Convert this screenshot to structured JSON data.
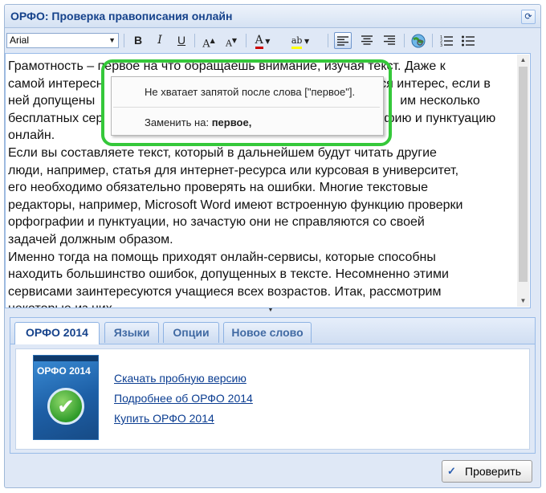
{
  "window": {
    "title": "ОРФО: Проверка правописания онлайн"
  },
  "toolbar": {
    "font": "Arial",
    "buttons": [
      {
        "name": "bold-button",
        "glyph": "B"
      },
      {
        "name": "italic-button",
        "glyph": "I"
      },
      {
        "name": "underline-button",
        "glyph": "U"
      },
      {
        "name": "increase-font-button",
        "glyph": "A↑"
      },
      {
        "name": "decrease-font-button",
        "glyph": "A↓"
      },
      {
        "name": "font-color-button",
        "glyph": "A"
      },
      {
        "name": "highlight-button",
        "glyph": "ab"
      },
      {
        "name": "align-left-button",
        "glyph": "≡"
      },
      {
        "name": "align-center-button",
        "glyph": "≡"
      },
      {
        "name": "align-right-button",
        "glyph": "≡"
      },
      {
        "name": "insert-link-button",
        "glyph": "🌐"
      },
      {
        "name": "numbered-list-button",
        "glyph": "⋮≡"
      },
      {
        "name": "bullet-list-button",
        "glyph": "⋮≡"
      }
    ],
    "colors": {
      "font_color_bar": "#cc0000",
      "highlight_bar": "#ffff00"
    }
  },
  "editor": {
    "text": {
      "l1": "Грамотность – первое на что обращаешь внимание, изучая текст. Даже к",
      "l2a": "самой интересн",
      "l2b": "ется интерес, если в",
      "l3a": "ней допущены",
      "l3b": "им несколько",
      "l4a": "бесплатных сер",
      "l4b": "фию и пунктуацию",
      "l5": "онлайн.",
      "l6": "Если вы составляете текст, который в дальнейшем будут читать другие",
      "l7": "люди, например, статья для интернет-ресурса или курсовая в университет,",
      "l8": "его необходимо обязательно проверять на ошибки. Многие текстовые",
      "l9": "редакторы, например, Microsoft Word имеют встроенную функцию проверки",
      "l10": "орфографии и пунктуации, но зачастую они не справляются со своей",
      "l11": "задачей должным образом.",
      "l12": "Именно тогда на помощь приходят онлайн-сервисы, которые способны",
      "l13": "находить большинство ошибок, допущенных в тексте. Несомненно этими",
      "l14": "сервисами заинтересуются учащиеся всех возрастов. Итак, рассмотрим",
      "l15": "некоторые из них."
    }
  },
  "popup": {
    "message": "Не хватает запятой после слова [\"первое\"].",
    "replace_label": "Заменить на:",
    "replace_value": "первое,"
  },
  "tabs": [
    {
      "label": "ОРФО 2014",
      "active": true
    },
    {
      "label": "Языки",
      "active": false
    },
    {
      "label": "Опции",
      "active": false
    },
    {
      "label": "Новое слово",
      "active": false
    }
  ],
  "product": {
    "box_logo": "ОРФО 2014",
    "links": [
      "Скачать пробную версию",
      "Подробнее об ОРФО 2014",
      "Купить ОРФО 2014"
    ]
  },
  "check_button": {
    "label": "Проверить"
  }
}
